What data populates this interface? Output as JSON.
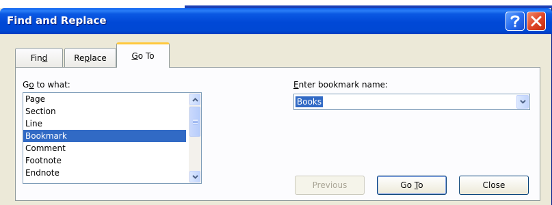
{
  "window": {
    "title": "Find and Replace"
  },
  "tabs": [
    {
      "label": "Find",
      "accel": "d"
    },
    {
      "label": "Replace",
      "accel": "p"
    },
    {
      "label": "Go To",
      "accel": "G"
    }
  ],
  "goto_what": {
    "label": "Go to what:",
    "items": [
      "Page",
      "Section",
      "Line",
      "Bookmark",
      "Comment",
      "Footnote",
      "Endnote"
    ],
    "selected": "Bookmark"
  },
  "bookmark": {
    "label": "Enter bookmark name:",
    "value": "Books"
  },
  "buttons": {
    "previous": "Previous",
    "goto": "Go To",
    "close": "Close"
  },
  "colors": {
    "titlebar": "#0048d6",
    "selection": "#316ac5",
    "active_tab_highlight": "#ffc83c",
    "close_button": "#e0482a"
  }
}
